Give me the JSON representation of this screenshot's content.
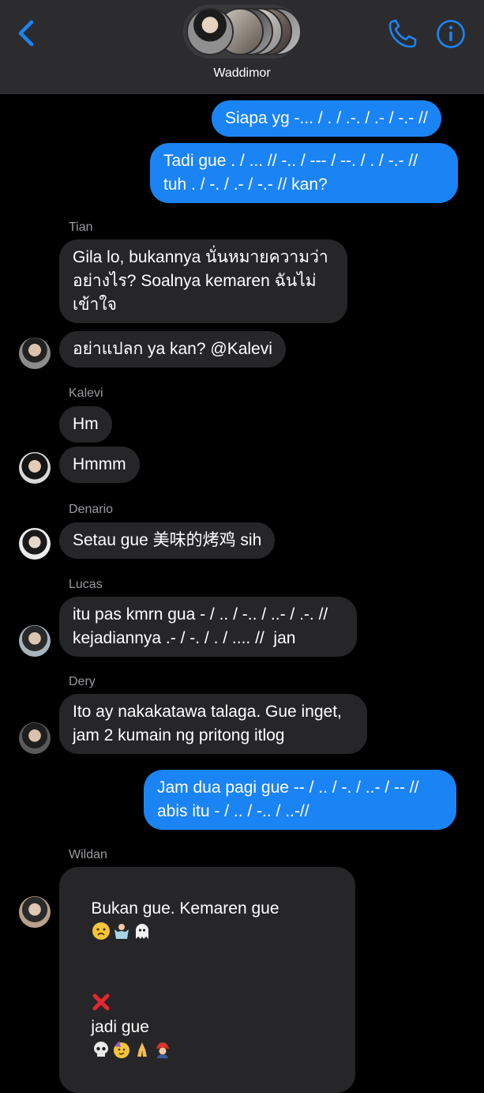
{
  "header": {
    "group_name": "Waddimor",
    "back_icon": "chevron-left-icon",
    "call_icon": "phone-icon",
    "info_icon": "info-icon",
    "accent_color": "#1b84f5"
  },
  "messages": [
    {
      "type": "out",
      "text": "Siapa yg -... / . / .-. / .- / -.- //"
    },
    {
      "type": "out",
      "text": "Tadi gue . / ... // -.. / --- / --. / . / -.- //\ntuh . / -. / .- / -.- // kan?"
    },
    {
      "type": "in",
      "sender": "Tian",
      "text": "Gila lo, bukannya นั่นหมายความว่า\nอย่างไร? Soalnya kemaren ฉันไม่\nเข้าใจ"
    },
    {
      "type": "in",
      "text": "อย่าแปลก ya kan? @Kalevi"
    },
    {
      "type": "in",
      "sender": "Kalevi",
      "text": "Hm"
    },
    {
      "type": "in",
      "text": "Hmmm"
    },
    {
      "type": "in",
      "sender": "Denario",
      "text": "Setau gue 美味的烤鸡 sih"
    },
    {
      "type": "in",
      "sender": "Lucas",
      "text": "itu pas kmrn gua - / .. / -.. / ..- / .-. //\nkejadiannya .- / -. / . / .... //  jan"
    },
    {
      "type": "in",
      "sender": "Dery",
      "text": "Ito ay nakakatawa talaga. Gue inget,\njam 2 kumain ng pritong itlog"
    },
    {
      "type": "out",
      "text": "Jam dua pagi gue -- / .. / -. / ..- / -- //\nabis itu - / .. / -.. / ..-//"
    },
    {
      "type": "in",
      "sender": "Wildan",
      "text_line1": "Bukan gue. Kemaren gue",
      "text_line2_a": "jadi gue"
    }
  ],
  "emoji_names": [
    "worried-face",
    "person-shrugging",
    "ghost",
    "red-cross-mark",
    "skull",
    "partying-face",
    "folded-hands",
    "firefighter"
  ]
}
